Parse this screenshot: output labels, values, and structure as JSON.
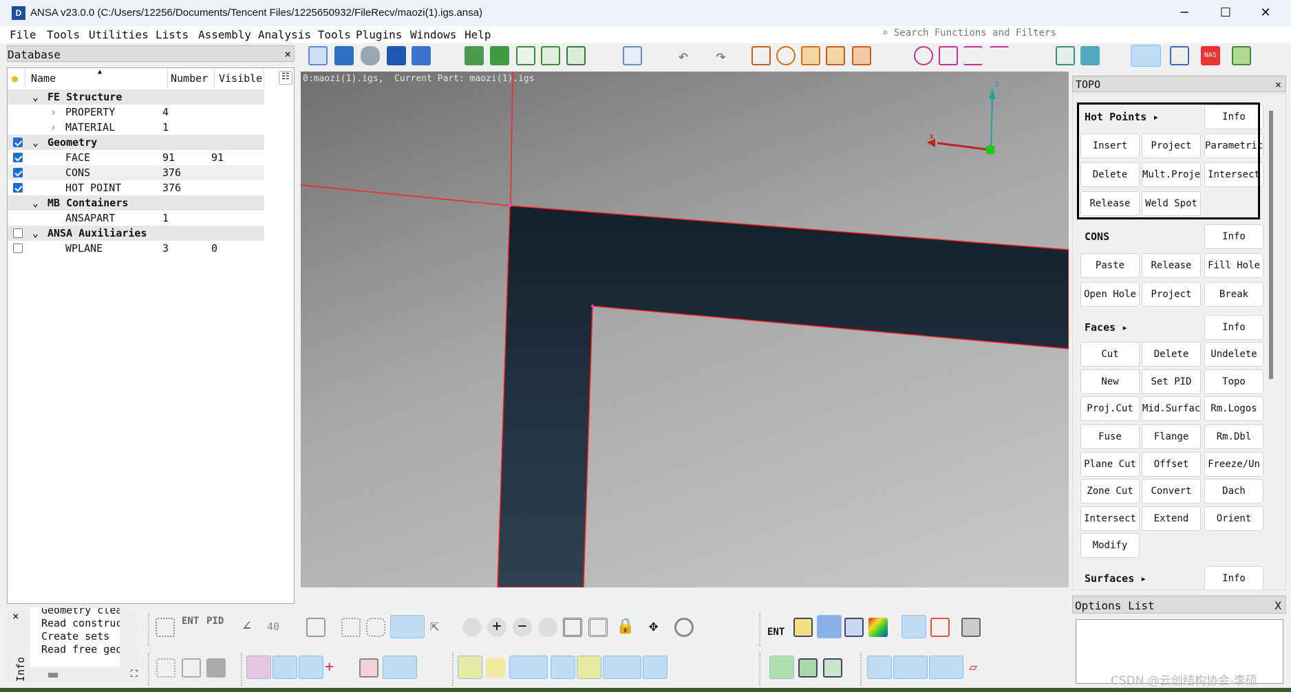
{
  "window": {
    "title": "ANSA v23.0.0 (C:/Users/12256/Documents/Tencent Files/1225650932/FileRecv/maozi(1).igs.ansa)",
    "app_icon": "ansa-logo",
    "minimize": "─",
    "maximize": "☐",
    "close": "✕"
  },
  "menu": [
    "File",
    "Tools",
    "Utilities",
    "Lists",
    "Assembly",
    "Analysis Tools",
    "Plugins",
    "Windows",
    "Help"
  ],
  "search": {
    "placeholder": "Search Functions and Filters"
  },
  "database": {
    "title": "Database",
    "close": "×",
    "columns": {
      "name": "Name",
      "number": "Number",
      "visible": "Visible"
    },
    "rows": [
      {
        "label": "FE Structure",
        "group": true,
        "expanded": true
      },
      {
        "label": "PROPERTY",
        "number": "4",
        "indent": true
      },
      {
        "label": "MATERIAL",
        "number": "1",
        "indent": true
      },
      {
        "label": "Geometry",
        "group": true,
        "expanded": true,
        "checked": true
      },
      {
        "label": "FACE",
        "number": "91",
        "visible": "91",
        "checked": true
      },
      {
        "label": "CONS",
        "number": "376",
        "checked": true
      },
      {
        "label": "HOT POINT",
        "number": "376",
        "checked": true
      },
      {
        "label": "MB Containers",
        "group": true,
        "expanded": true
      },
      {
        "label": "ANSAPART",
        "number": "1"
      },
      {
        "label": "ANSA Auxiliaries",
        "group": true,
        "expanded": true,
        "checked": false
      },
      {
        "label": "WPLANE",
        "number": "3",
        "visible": "0",
        "checked": false
      }
    ]
  },
  "viewport": {
    "label": "0:maozi(1).igs,  Current Part: maozi(1).igs",
    "axis_x": "x",
    "axis_z": "z",
    "part_color": "#1a2a38",
    "edge_color": "#ff2020"
  },
  "topo": {
    "title": "TOPO",
    "close": "×",
    "sections": [
      {
        "title": "Hot Points ▸",
        "info": "Info",
        "buttons": [
          "Insert",
          "Project",
          "Parametric.",
          "Delete",
          "Mult.Proje.",
          "Intersect",
          "Release",
          "Weld Spot"
        ]
      },
      {
        "title": "CONS",
        "info": "Info",
        "buttons": [
          "Paste",
          "Release",
          "Fill Hole",
          "Open Hole",
          "Project",
          "Break"
        ]
      },
      {
        "title": "Faces ▸",
        "info": "Info",
        "buttons": [
          "Cut",
          "Delete",
          "Undelete",
          "New",
          "Set PID",
          "Topo",
          "Proj.Cut",
          "Mid.Surfac.",
          "Rm.Logos",
          "Fuse",
          "Flange",
          "Rm.Dbl",
          "Plane Cut",
          "Offset",
          "Freeze/Un",
          "Zone Cut",
          "Convert",
          "Dach",
          "Intersect",
          "Extend",
          "Orient",
          "Modify"
        ]
      },
      {
        "title": "Surfaces ▸",
        "info": "Info",
        "buttons": []
      }
    ]
  },
  "options_list": {
    "title": "Options List",
    "close": "X"
  },
  "info_panel": {
    "tab": "Info",
    "close": "×",
    "lines": [
      "Geometry clea",
      "Read construc",
      "Create sets",
      "Read free geo"
    ]
  },
  "bottom_toolbar": {
    "ent": "ENT",
    "pid": "PID",
    "angle": "40",
    "ent2": "ENT"
  },
  "watermark": "CSDN @云创结构协会-李硕"
}
